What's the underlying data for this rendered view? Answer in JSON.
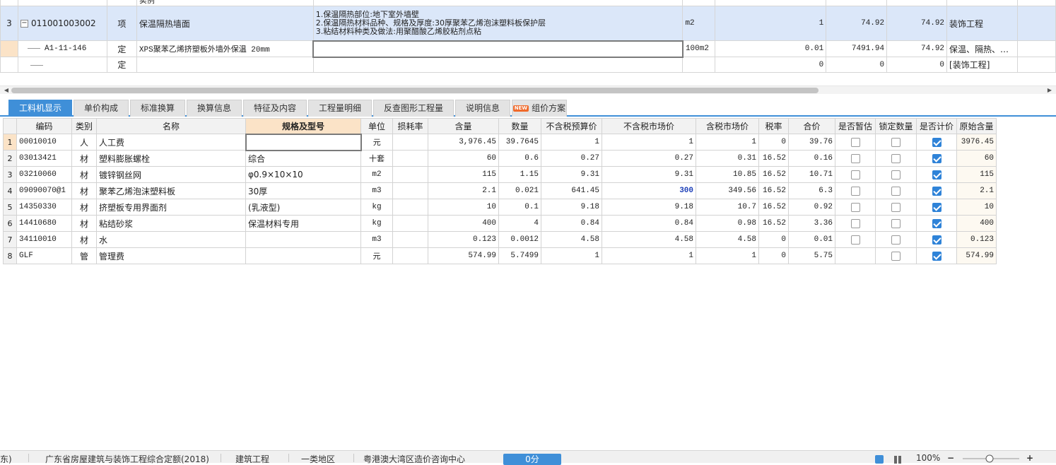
{
  "top_grid": {
    "partial_row_text": "实例",
    "rows": [
      {
        "row_no": "3",
        "code": "011001003002",
        "type": "项",
        "name": "保温隔热墙面",
        "features": [
          "1.保温隔热部位:地下室外墙壁",
          "2.保温隔热材料品种、规格及厚度:30厚聚苯乙烯泡沫塑料板保护层",
          "3.粘结材料种类及做法:用聚醋酸乙烯胶粘剂点粘"
        ],
        "unit": "m2",
        "qty": "1",
        "price": "74.92",
        "total": "74.92",
        "category": "装饰工程"
      },
      {
        "row_no": "",
        "code": "A1-11-146",
        "type": "定",
        "name": "XPS聚苯乙烯挤塑板外墙外保温 20mm",
        "features_value": "",
        "unit": "100m2",
        "qty": "0.01",
        "price": "7491.94",
        "total": "74.92",
        "category": "保温、隔热、…"
      },
      {
        "row_no": "",
        "code": "",
        "type": "定",
        "name": "",
        "unit": "",
        "qty": "0",
        "price": "0",
        "total": "0",
        "category": "[装饰工程]"
      }
    ]
  },
  "tabs": [
    {
      "label": "工料机显示",
      "active": true
    },
    {
      "label": "单价构成"
    },
    {
      "label": "标准换算"
    },
    {
      "label": "换算信息"
    },
    {
      "label": "特征及内容"
    },
    {
      "label": "工程量明细"
    },
    {
      "label": "反查图形工程量"
    },
    {
      "label": "说明信息"
    },
    {
      "label": "组价方案",
      "badge": "NEW"
    }
  ],
  "resource_table": {
    "headers": [
      "编码",
      "类别",
      "名称",
      "规格及型号",
      "单位",
      "损耗率",
      "含量",
      "数量",
      "不含税预算价",
      "不含税市场价",
      "含税市场价",
      "税率",
      "合价",
      "是否暂估",
      "锁定数量",
      "是否计价",
      "原始含量"
    ],
    "rows": [
      {
        "n": "1",
        "code": "00010010",
        "cat": "人",
        "name": "人工费",
        "spec": "",
        "unit": "元",
        "loss": "",
        "content": "3,976.45",
        "qty": "39.7645",
        "budget": "1",
        "market": "1",
        "market_tax": "1",
        "tax": "0",
        "total": "39.76",
        "temp": false,
        "lock": false,
        "priced": true,
        "orig": "3976.45"
      },
      {
        "n": "2",
        "code": "03013421",
        "cat": "材",
        "name": "塑料膨胀螺栓",
        "spec": "综合",
        "unit": "十套",
        "loss": "",
        "content": "60",
        "qty": "0.6",
        "budget": "0.27",
        "market": "0.27",
        "market_tax": "0.31",
        "tax": "16.52",
        "total": "0.16",
        "temp": false,
        "lock": false,
        "priced": true,
        "orig": "60"
      },
      {
        "n": "3",
        "code": "03210060",
        "cat": "材",
        "name": "镀锌钢丝网",
        "spec": "φ0.9×10×10",
        "unit": "m2",
        "loss": "",
        "content": "115",
        "qty": "1.15",
        "budget": "9.31",
        "market": "9.31",
        "market_tax": "10.85",
        "tax": "16.52",
        "total": "10.71",
        "temp": false,
        "lock": false,
        "priced": true,
        "orig": "115"
      },
      {
        "n": "4",
        "code": "09090070@1",
        "cat": "材",
        "name": "聚苯乙烯泡沫塑料板",
        "spec": "30厚",
        "unit": "m3",
        "loss": "",
        "content": "2.1",
        "qty": "0.021",
        "budget": "641.45",
        "market": "300",
        "market_tax": "349.56",
        "tax": "16.52",
        "total": "6.3",
        "temp": false,
        "lock": false,
        "priced": true,
        "orig": "2.1"
      },
      {
        "n": "5",
        "code": "14350330",
        "cat": "材",
        "name": "挤塑板专用界面剂",
        "spec": "(乳液型)",
        "unit": "kg",
        "loss": "",
        "content": "10",
        "qty": "0.1",
        "budget": "9.18",
        "market": "9.18",
        "market_tax": "10.7",
        "tax": "16.52",
        "total": "0.92",
        "temp": false,
        "lock": false,
        "priced": true,
        "orig": "10"
      },
      {
        "n": "6",
        "code": "14410680",
        "cat": "材",
        "name": "粘结砂浆",
        "spec": "保温材料专用",
        "unit": "kg",
        "loss": "",
        "content": "400",
        "qty": "4",
        "budget": "0.84",
        "market": "0.84",
        "market_tax": "0.98",
        "tax": "16.52",
        "total": "3.36",
        "temp": false,
        "lock": false,
        "priced": true,
        "orig": "400"
      },
      {
        "n": "7",
        "code": "34110010",
        "cat": "材",
        "name": "水",
        "spec": "",
        "unit": "m3",
        "loss": "",
        "content": "0.123",
        "qty": "0.0012",
        "budget": "4.58",
        "market": "4.58",
        "market_tax": "4.58",
        "tax": "0",
        "total": "0.01",
        "temp": false,
        "lock": false,
        "priced": true,
        "orig": "0.123"
      },
      {
        "n": "8",
        "code": "GLF",
        "cat": "管",
        "name": "管理费",
        "spec": "",
        "unit": "元",
        "loss": "",
        "content": "574.99",
        "qty": "5.7499",
        "budget": "1",
        "market": "1",
        "market_tax": "1",
        "tax": "0",
        "total": "5.75",
        "temp": null,
        "lock": false,
        "priced": true,
        "orig": "574.99"
      }
    ]
  },
  "status_bar": {
    "left_partial": "东)",
    "quota": "广东省房屋建筑与装饰工程综合定额(2018)",
    "project_type": "建筑工程",
    "region": "一类地区",
    "center": "粤港澳大湾区造价咨询中心",
    "score": "0分",
    "zoom": "100%"
  },
  "colors": {
    "accent": "#3f8fd8",
    "selected_row": "#dbe7f9",
    "selected_header": "#fbe3c7",
    "highlight_value": "#1c3fb8"
  }
}
